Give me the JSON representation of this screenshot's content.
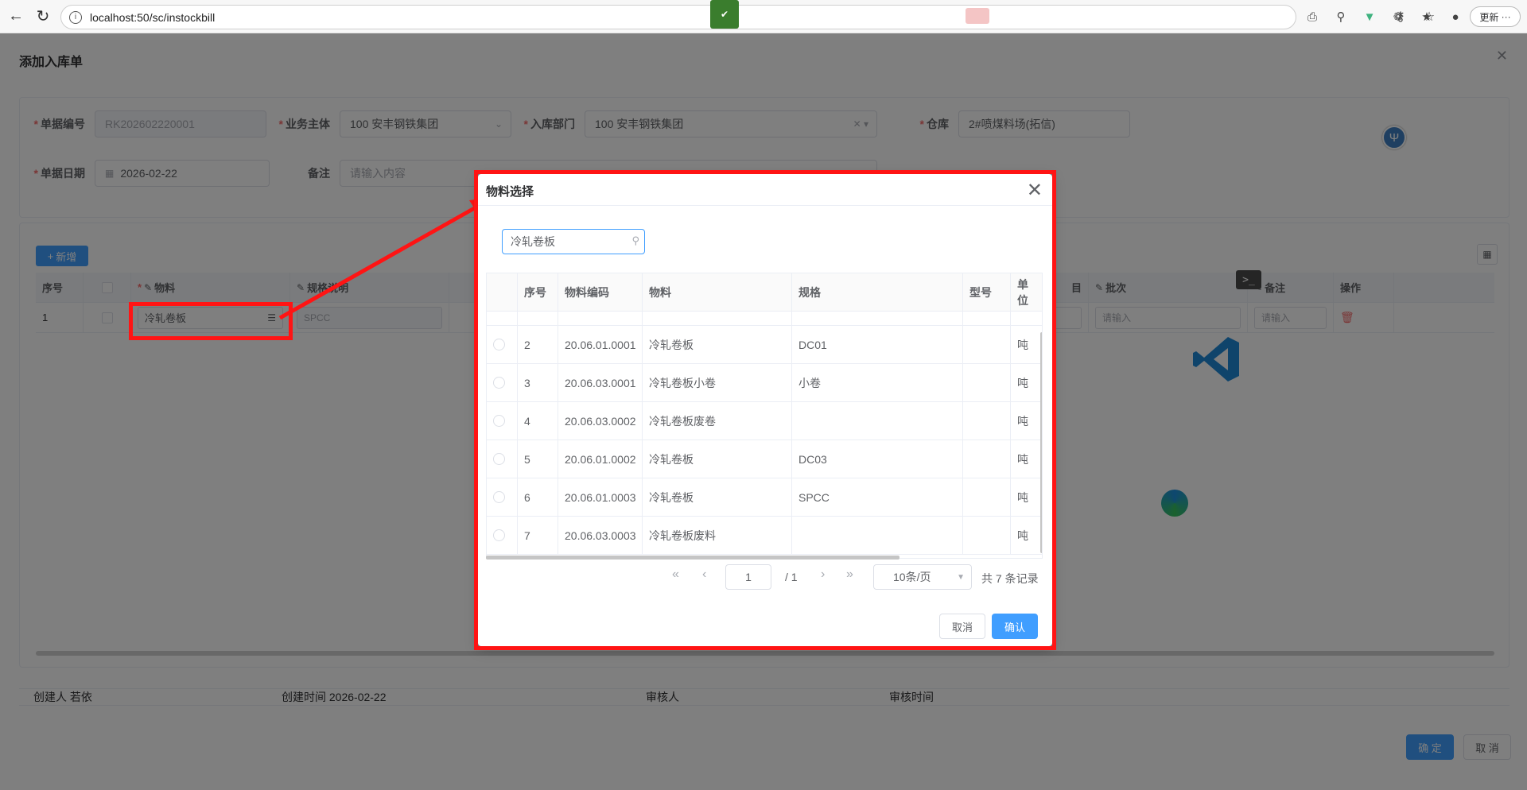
{
  "browser": {
    "url": "localhost:50/sc/instockbill",
    "update_label": "更新",
    "more": "···"
  },
  "dialog": {
    "title": "添加入库单",
    "form": {
      "bill_no_label": "单据编号",
      "bill_no_value": "RK202602220001",
      "entity_label": "业务主体",
      "entity_value": "100 安丰钢铁集团",
      "dept_label": "入库部门",
      "dept_value": "100 安丰钢铁集团",
      "warehouse_label": "仓库",
      "warehouse_value": "2#喷煤料场(拓信)",
      "date_label": "单据日期",
      "date_value": "2026-02-22",
      "remark_label": "备注",
      "remark_placeholder": "请输入内容"
    },
    "add_button": "新增",
    "table": {
      "headers": [
        "序号",
        "物料",
        "规格说明",
        "目",
        "批次",
        "备注",
        "操作"
      ],
      "row": {
        "index": "1",
        "material": "冷轧卷板",
        "spec": "SPCC",
        "placeholder": "请输入",
        "placeholder_tail": "入"
      }
    },
    "footer": {
      "creator": "创建人 若依",
      "created_at": "创建时间 2026-02-22",
      "auditor": "审核人",
      "audit_time": "审核时间"
    },
    "confirm": "确 定",
    "cancel": "取 消"
  },
  "modal": {
    "title": "物料选择",
    "search_value": "冷轧卷板",
    "headers": [
      "序号",
      "物料编码",
      "物料",
      "规格",
      "型号",
      "单位"
    ],
    "rows": [
      {
        "no": "2",
        "code": "20.06.01.0001",
        "name": "冷轧卷板",
        "spec": "DC01",
        "model": "",
        "unit": "吨"
      },
      {
        "no": "3",
        "code": "20.06.03.0001",
        "name": "冷轧卷板小卷",
        "spec": "小卷",
        "model": "",
        "unit": "吨"
      },
      {
        "no": "4",
        "code": "20.06.03.0002",
        "name": "冷轧卷板废卷",
        "spec": "",
        "model": "",
        "unit": "吨"
      },
      {
        "no": "5",
        "code": "20.06.01.0002",
        "name": "冷轧卷板",
        "spec": "DC03",
        "model": "",
        "unit": "吨"
      },
      {
        "no": "6",
        "code": "20.06.01.0003",
        "name": "冷轧卷板",
        "spec": "SPCC",
        "model": "",
        "unit": "吨"
      },
      {
        "no": "7",
        "code": "20.06.03.0003",
        "name": "冷轧卷板废料",
        "spec": "",
        "model": "",
        "unit": "吨"
      }
    ],
    "pager": {
      "current_page": "1",
      "total_pages": "/ 1",
      "page_size": "10条/页",
      "total": "共 7 条记录"
    },
    "cancel": "取消",
    "confirm": "确认"
  },
  "colors": {
    "primary": "#409eff",
    "highlight": "#ff1414",
    "danger": "#f56c6c"
  }
}
